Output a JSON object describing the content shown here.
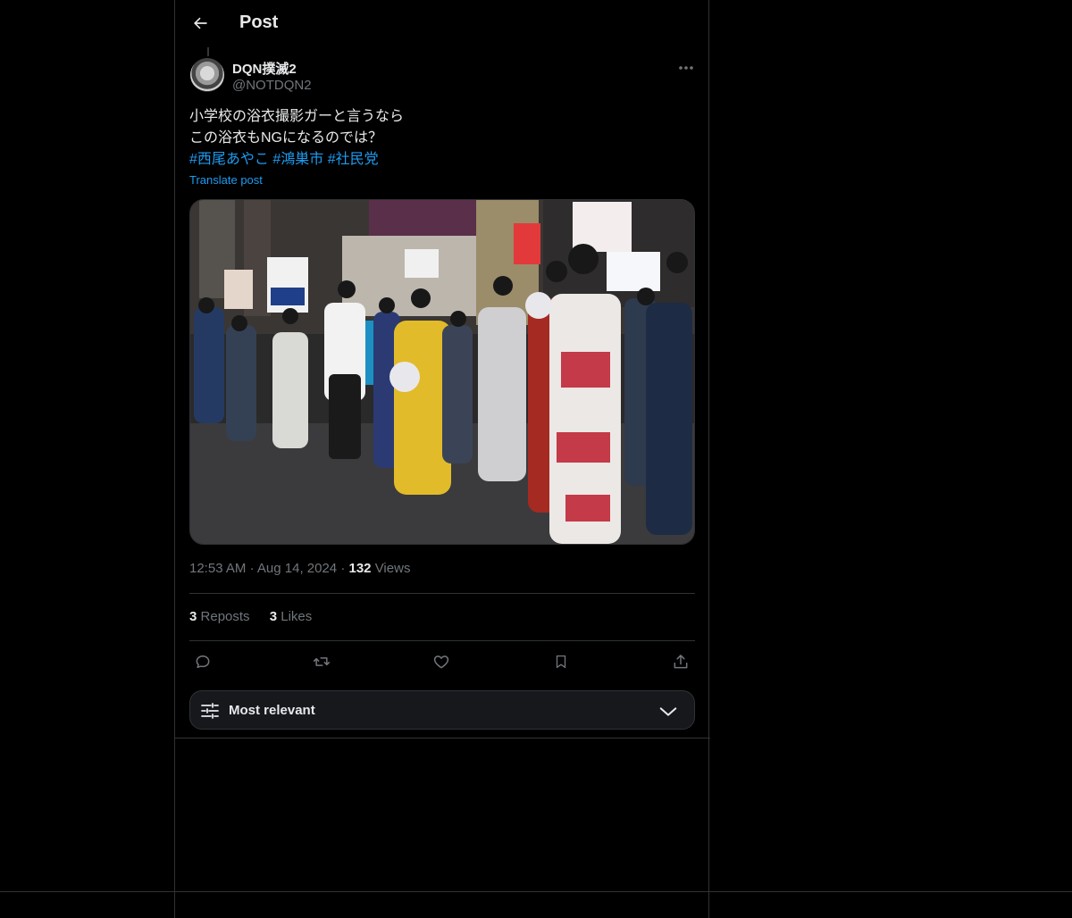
{
  "header": {
    "title": "Post",
    "back_icon": "arrow-left-icon"
  },
  "post": {
    "author": {
      "name": "DQN撲滅2",
      "handle": "@NOTDQN2"
    },
    "text_lines": [
      "小学校の浴衣撮影ガーと言うなら",
      "この浴衣もNGになるのでは？"
    ],
    "hashtags": [
      "#西尾あやこ",
      "#鴻巣市",
      "#社民党"
    ],
    "translate_label": "Translate post",
    "time": "12:53 AM",
    "date": "Aug 14, 2024",
    "views_count": "132",
    "views_label": "Views",
    "reposts_count": "3",
    "reposts_label": "Reposts",
    "likes_count": "3",
    "likes_label": "Likes"
  },
  "reply_sort": {
    "label": "Most relevant"
  },
  "colors": {
    "accent": "#1d9bf0",
    "text": "#e7e9ea",
    "muted": "#71767b",
    "border": "#2f3336",
    "background": "#000000"
  }
}
